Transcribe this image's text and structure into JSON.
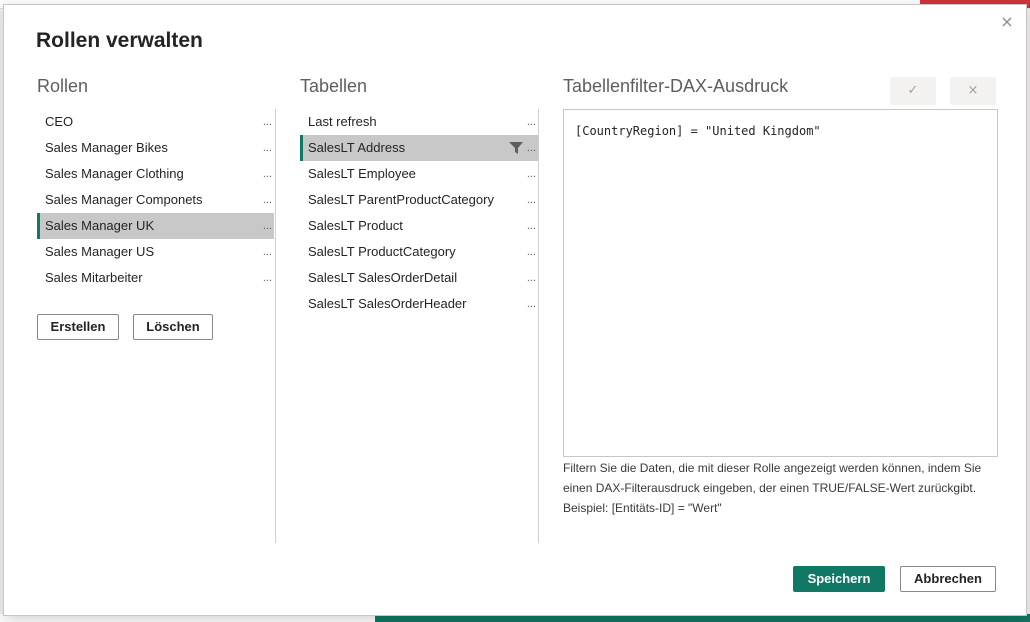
{
  "dialog": {
    "title": "Rollen verwalten",
    "close_glyph": "×"
  },
  "roles": {
    "heading": "Rollen",
    "items": [
      {
        "label": "CEO",
        "more": "..."
      },
      {
        "label": "Sales Manager Bikes",
        "more": "..."
      },
      {
        "label": "Sales Manager Clothing",
        "more": "..."
      },
      {
        "label": "Sales Manager Componets",
        "more": "..."
      },
      {
        "label": "Sales Manager UK",
        "more": "...",
        "selected": true
      },
      {
        "label": "Sales Manager US",
        "more": "..."
      },
      {
        "label": "Sales Mitarbeiter",
        "more": "..."
      }
    ],
    "create_label": "Erstellen",
    "delete_label": "Löschen"
  },
  "tables": {
    "heading": "Tabellen",
    "items": [
      {
        "label": "Last refresh",
        "more": "..."
      },
      {
        "label": "SalesLT Address",
        "more": "...",
        "selected": true,
        "filtered": true
      },
      {
        "label": "SalesLT Employee",
        "more": "..."
      },
      {
        "label": "SalesLT ParentProductCategory",
        "more": "..."
      },
      {
        "label": "SalesLT Product",
        "more": "..."
      },
      {
        "label": "SalesLT ProductCategory",
        "more": "..."
      },
      {
        "label": "SalesLT SalesOrderDetail",
        "more": "..."
      },
      {
        "label": "SalesLT SalesOrderHeader",
        "more": "..."
      }
    ]
  },
  "filter": {
    "heading": "Tabellenfilter-DAX-Ausdruck",
    "confirm_glyph": "✓",
    "cancel_glyph": "×",
    "expression": "[CountryRegion] = \"United Kingdom\"",
    "help": "Filtern Sie die Daten, die mit dieser Rolle angezeigt werden können, indem Sie einen DAX-Filterausdruck eingeben, der einen TRUE/FALSE-Wert zurückgibt. Beispiel: [Entitäts-ID] = \"Wert\""
  },
  "footer": {
    "save_label": "Speichern",
    "cancel_label": "Abbrechen"
  },
  "colors": {
    "accent": "#117865",
    "selected_bg": "#c8c8c8"
  },
  "icons": {
    "filter": "filter-icon",
    "check": "check-icon",
    "close": "close-icon"
  }
}
